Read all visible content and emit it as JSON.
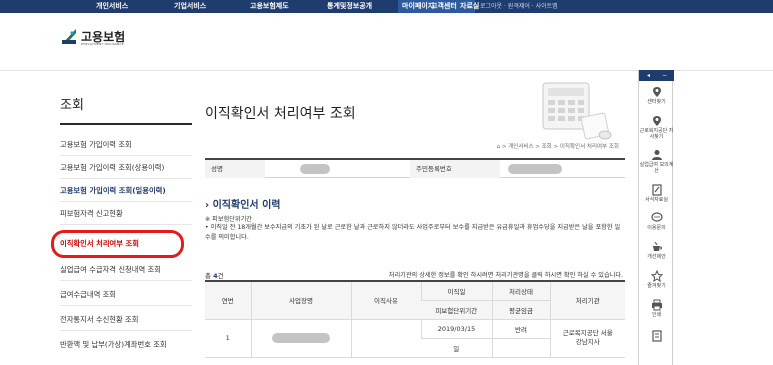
{
  "topnav": {
    "items": [
      "개인서비스",
      "기업서비스",
      "고용보험제도",
      "통계및정보공개"
    ],
    "mypage": "마이페이지",
    "customer": "고객센터",
    "archive": "자료실",
    "util": "로그아웃 · 원격제어 · 사이트맵"
  },
  "logo": {
    "title": "고용보험",
    "subtitle": "EMPLOYMENT INSURANCE"
  },
  "sidebar": {
    "title": "조회",
    "items": [
      "고용보험 가입이력 조회",
      "고용보험 가입이력 조회(상용이력)",
      "고용보험 가입이력 조회(일용이력)",
      "피보험자격 신고현황",
      "이직확인서 처리여부 조회",
      "실업급여 수급자격 신청내역 조회",
      "급여수급내역 조회",
      "전자통지서 수신현황 조회",
      "반환액 및 납부(가상)계좌번호 조회"
    ]
  },
  "main": {
    "title": "이직확인서 처리여부 조회",
    "breadcrumb": "> 개인서비스 > 조회 > 이직확인서 처리여부 조회",
    "info": {
      "name_label": "성명",
      "rrn_label": "주민등록번호"
    },
    "section_title": "이직확인서 이력",
    "note_title": "※ 피보험단위기간",
    "note_body": "• 이직일 전 18개월간 보수지급의 기초가 된 날로 근로한 날과 근로하지 않더라도 사업주로부터 보수를 지급받은 유급휴일과 휴업수당을 지급받은 날을 포함한 일수를 의미합니다.",
    "count_label": "총",
    "count_value": "4",
    "count_unit": "건",
    "hint": "처리기관의 상세한 정보를 확인 하시려면 처리기관명을 클릭 하시면 확인 하실 수 있습니다.",
    "table": {
      "headers": {
        "no": "연번",
        "workplace": "사업장명",
        "reason": "이직사유",
        "leave_date": "이직일",
        "status": "처리상태",
        "agency": "처리기관",
        "insured_period": "피보험단위기간",
        "avg_wage": "평균임금"
      },
      "rows": [
        {
          "no": "1",
          "leave_date": "2019/03/15",
          "status": "반려",
          "agency": "근로복지공단 서울강남지사",
          "insured_period": "일"
        }
      ]
    }
  },
  "quickbar": {
    "items": [
      "센터찾기",
      "근로복지공단 지사찾기",
      "실업급여 모의계산",
      "서식자료실",
      "이용문의",
      "개선제안",
      "즐겨찾기",
      "인쇄"
    ]
  },
  "colors": {
    "nav": "#1f3c6e",
    "highlight": "#e41b1b"
  }
}
